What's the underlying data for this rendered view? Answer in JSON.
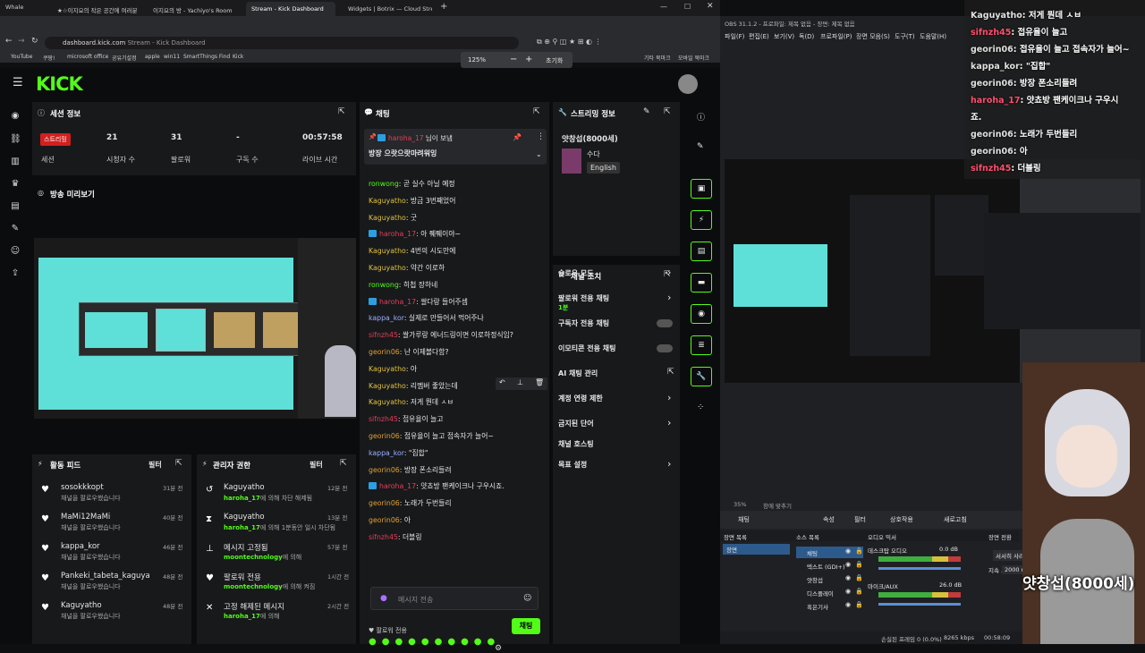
{
  "browser": {
    "window_title": "Whale",
    "tabs": [
      "★☆이지요의 작은 공간에 여러분",
      "이지요의 방 - Yachiyo's Room",
      "Stream - Kick Dashboard",
      "Widgets | Botrix — Cloud Stre"
    ],
    "url_host": "dashboard.kick.com",
    "url_rest": "Stream - Kick Dashboard",
    "bookmarks": [
      "YouTube",
      "쿠팡!",
      "microsoft office",
      "공유기설정",
      "apple",
      "win11",
      "SmartThings Find",
      "Kick"
    ],
    "bookmarks_right": [
      "기타 북마크",
      "모바일 북마크"
    ],
    "zoom": "125%",
    "zoom_reset": "초기화"
  },
  "session": {
    "title": "세션 정보",
    "live_badge": "스트리밍",
    "stats": [
      {
        "value": "",
        "label": "세션"
      },
      {
        "value": "21",
        "label": "시청자 수"
      },
      {
        "value": "31",
        "label": "팔로워"
      },
      {
        "value": "-",
        "label": "구독 수"
      },
      {
        "value": "00:57:58",
        "label": "라이브 시간"
      }
    ]
  },
  "preview": {
    "title": "방송 미리보기"
  },
  "activity": {
    "title": "활동 피드",
    "filter": "필터",
    "items": [
      {
        "name": "sosokkkopt",
        "sub": "채널을 팔로우했습니다",
        "time": "31분 전"
      },
      {
        "name": "MaMi12MaMi",
        "sub": "채널을 팔로우했습니다",
        "time": "40분 전"
      },
      {
        "name": "kappa_kor",
        "sub": "채널을 팔로우했습니다",
        "time": "46분 전"
      },
      {
        "name": "Pankeki_tabeta_kaguya",
        "sub": "채널을 팔로우했습니다",
        "time": "48분 전"
      },
      {
        "name": "Kaguyatho",
        "sub": "채널을 팔로우했습니다",
        "time": "48분 전"
      }
    ]
  },
  "mod": {
    "title": "관리자 권한",
    "filter": "필터",
    "items": [
      {
        "name": "Kaguyatho",
        "who": "haroha_17",
        "sub": "에 의해 차단 해제됨",
        "time": "12분 전",
        "icon": "undo-icon"
      },
      {
        "name": "Kaguyatho",
        "who": "haroha_17",
        "sub": "에 의해 1분동안 일시 차단됨",
        "time": "13분 전",
        "icon": "timeout-icon"
      },
      {
        "name": "메시지 고정됨",
        "who": "moontechnology",
        "sub": "에 의해",
        "time": "57분 전",
        "icon": "pin-icon"
      },
      {
        "name": "팔로워 전용",
        "who": "moontechnology",
        "sub": "에 의해 켜짐",
        "time": "1시간 전",
        "icon": "heart-icon"
      },
      {
        "name": "고정 해제된 메시지",
        "who": "haroha_17",
        "sub": "에 의해",
        "time": "2시간 전",
        "icon": "unpin-icon"
      }
    ]
  },
  "chat": {
    "title": "채팅",
    "pinned_user": "haroha_17",
    "pinned_suffix": "님이 보냄",
    "pinned_text": "방장 으랏으랏마려워잉",
    "lines": [
      {
        "user": "ronwong",
        "text": "곧 실수 아닐 예정",
        "color": "#53fc18",
        "badge": false
      },
      {
        "user": "Kaguyatho",
        "text": "방금 3번째었어",
        "color": "#e0c23c",
        "badge": false
      },
      {
        "user": "Kaguyatho",
        "text": "굿",
        "color": "#e0c23c",
        "badge": false
      },
      {
        "user": "haroha_17",
        "text": "아 쮀쮀이야~",
        "color": "#e43f5a",
        "badge": true
      },
      {
        "user": "Kaguyatho",
        "text": "4번의 시도만에",
        "color": "#e0c23c",
        "badge": false
      },
      {
        "user": "Kaguyatho",
        "text": "약간 이로하",
        "color": "#e0c23c",
        "badge": false
      },
      {
        "user": "ronwong",
        "text": "히첩 장하네",
        "color": "#53fc18",
        "badge": false
      },
      {
        "user": "haroha_17",
        "text": "쌀다랑 들어주셈",
        "color": "#e43f5a",
        "badge": true
      },
      {
        "user": "kappa_kor",
        "text": "실제로 만들어서 먹어주나",
        "color": "#9ab0ff",
        "badge": false
      },
      {
        "user": "sifnzh45",
        "text": "쌀가루랑 에너드링이면 이로하정식임?",
        "color": "#e43f5a",
        "badge": false
      },
      {
        "user": "georin06",
        "text": "난 이제볼다함?",
        "color": "#e0a030",
        "badge": false
      },
      {
        "user": "Kaguyatho",
        "text": "아",
        "color": "#e0c23c",
        "badge": false
      },
      {
        "user": "Kaguyatho",
        "text": "리멤버 좋았는데",
        "color": "#e0c23c",
        "badge": false
      },
      {
        "user": "Kaguyatho",
        "text": "저게 뭔데 ㅅㅂ",
        "color": "#e0c23c",
        "badge": false
      },
      {
        "user": "sifnzh45",
        "text": "접유율이 늘고",
        "color": "#e43f5a",
        "badge": false
      },
      {
        "user": "georin06",
        "text": "접유율이 늘고 접속자가 늘어~",
        "color": "#e0a030",
        "badge": false
      },
      {
        "user": "kappa_kor",
        "text": "\"집합\"",
        "color": "#9ab0ff",
        "badge": false
      },
      {
        "user": "georin06",
        "text": "방장 폰소리들려",
        "color": "#e0a030",
        "badge": false
      },
      {
        "user": "haroha_17",
        "text": "얏쵸방 팬케이크나 구우시죠.",
        "color": "#e43f5a",
        "badge": true
      },
      {
        "user": "georin06",
        "text": "노래가 두번들리",
        "color": "#e0a030",
        "badge": false
      },
      {
        "user": "georin06",
        "text": "아",
        "color": "#e0a030",
        "badge": false
      },
      {
        "user": "sifnzh45",
        "text": "더블링",
        "color": "#e43f5a",
        "badge": false
      }
    ],
    "follower_only": "팔로워 전용",
    "input_placeholder": "메시지 전송",
    "send_label": "채팅"
  },
  "stream_info": {
    "title": "스트리밍 정보",
    "stream_title": "얏창섭(8000세)",
    "category": "수다",
    "language": "English"
  },
  "channel_actions": {
    "title": "채널 조치",
    "items": [
      {
        "label": "슬로우 모드",
        "sub": "",
        "control": "chevron"
      },
      {
        "label": "팔로워 전용 채팅",
        "sub": "1분",
        "control": "chevron"
      },
      {
        "label": "구독자 전용 채팅",
        "sub": "",
        "control": "toggle"
      },
      {
        "label": "이모티콘 전용 채팅",
        "sub": "",
        "control": "toggle"
      },
      {
        "label": "AI 채팅 관리",
        "sub": "",
        "control": "external"
      },
      {
        "label": "계정 연령 제한",
        "sub": "",
        "control": "chevron"
      },
      {
        "label": "금지된 단어",
        "sub": "",
        "control": "chevron"
      },
      {
        "label": "채널 호스팅",
        "sub": "",
        "control": "none"
      },
      {
        "label": "목표 설정",
        "sub": "",
        "control": "chevron"
      }
    ]
  },
  "obs": {
    "title": "OBS 31.1.2 - 프로파일: 제목 없음 - 장면: 제목 없음",
    "menu": [
      "파일(F)",
      "편집(E)",
      "보기(V)",
      "독(D)",
      "프로파일(P)",
      "장면 모음(S)",
      "도구(T)",
      "도움말(H)"
    ],
    "zoom": "35%",
    "fit": "창에 맞추기",
    "scene_bar": [
      "채팅",
      "속성",
      "필터",
      "상호작용",
      "새로고침"
    ],
    "scenes_title": "장면 목록",
    "scene_item": "장면",
    "sources_title": "소스 목록",
    "sources": [
      "채팅",
      "텍스트 (GDI+)",
      "얏창섭",
      "디스플레이",
      "혹은기사"
    ],
    "mixer_title": "오디오 믹서",
    "mixer": [
      {
        "name": "데스크탑 오디오",
        "db": "0.0 dB"
      },
      {
        "name": "마이크/AUX",
        "db": "26.0 dB"
      }
    ],
    "transition_title": "장면 전환",
    "transition_type": "서서히 사라지기",
    "duration_label": "지속 시간",
    "duration": "2000 ms",
    "status_frames": "손실된 프레임 0 (0.0%)",
    "status_kbps": "8265 kbps",
    "status_time": "00:58:09"
  },
  "overlay": {
    "lines": [
      {
        "user": "Kaguyatho",
        "text": "저게 뭔데 ㅅㅂ",
        "cls": "n"
      },
      {
        "user": "sifnzh45",
        "text": "접유율이 늘고",
        "cls": "r"
      },
      {
        "user": "georin06",
        "text": "접유율이 늘고 접속자가 늘어~",
        "cls": "n"
      },
      {
        "user": "kappa_kor",
        "text": "\"집합\"",
        "cls": "n"
      },
      {
        "user": "georin06",
        "text": "방장 폰소리들려",
        "cls": "n"
      },
      {
        "user": "haroha_17",
        "text": "얏쵸방 팬케이크나 구우시",
        "cls": "r"
      },
      {
        "user": "",
        "text": "죠.",
        "cls": "n"
      },
      {
        "user": "georin06",
        "text": "노래가 두번들리",
        "cls": "n"
      },
      {
        "user": "georin06",
        "text": "아",
        "cls": "n"
      },
      {
        "user": "sifnzh45",
        "text": "더블링",
        "cls": "r"
      }
    ],
    "caption": "얏창섭(8000세)"
  }
}
